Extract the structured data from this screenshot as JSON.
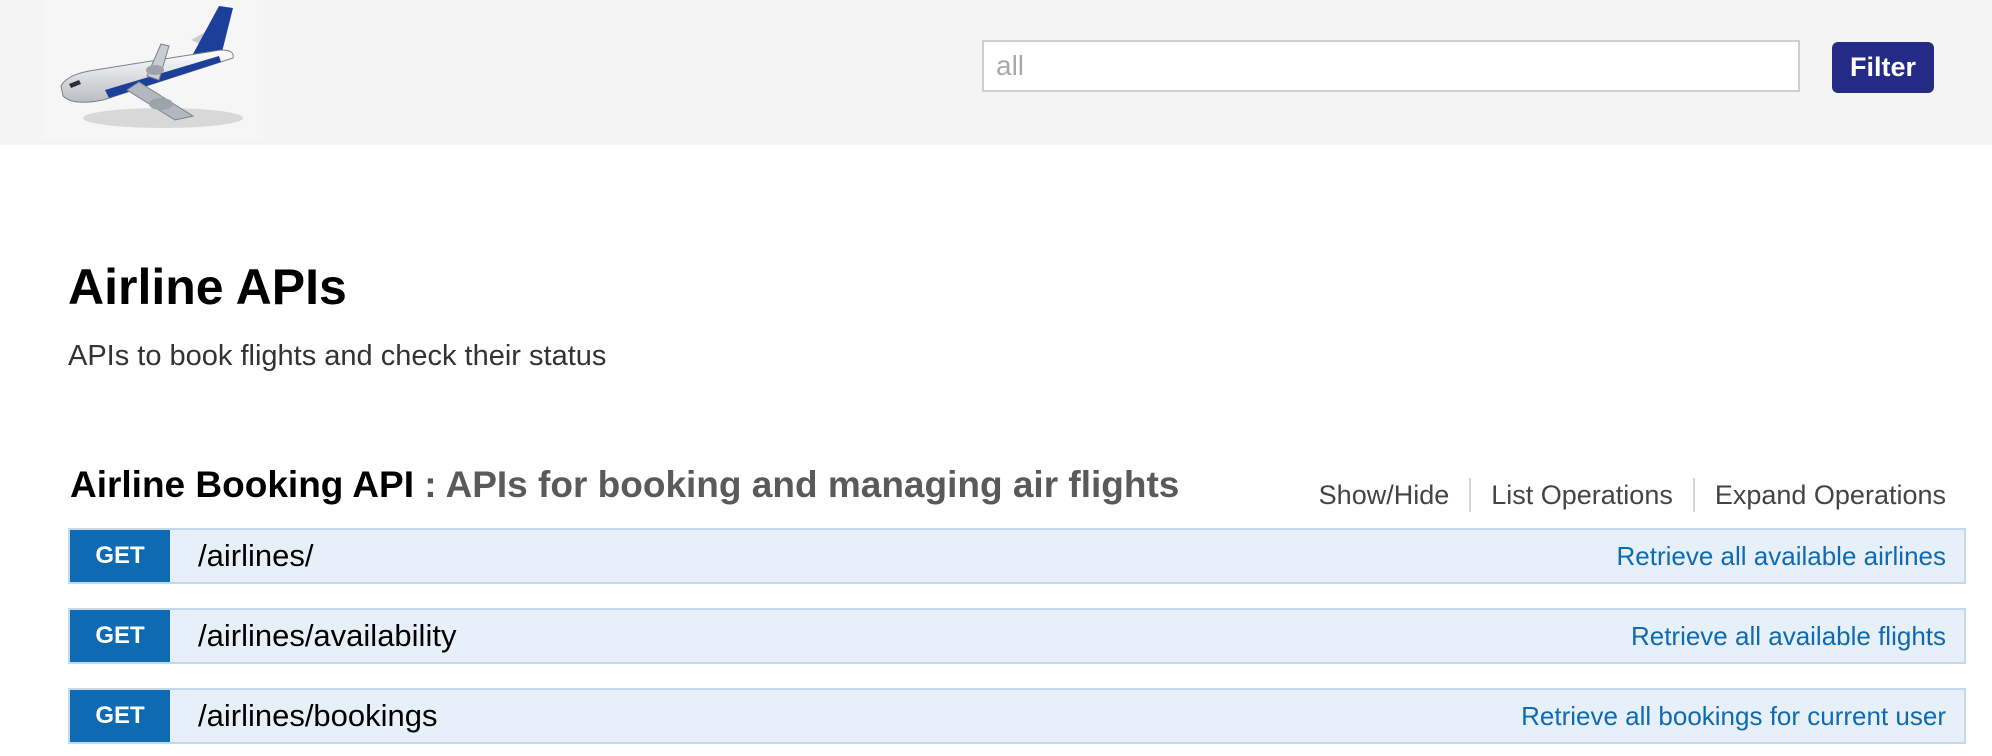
{
  "header": {
    "logo_icon": "airplane-logo-icon",
    "filter_placeholder": "all",
    "filter_value": "",
    "filter_button_label": "Filter",
    "filter_button_color": "#232b86"
  },
  "info": {
    "title": "Airline APIs",
    "description": "APIs to book flights and check their status"
  },
  "resource": {
    "name": "Airline Booking API",
    "separator": " : ",
    "description": "APIs for booking and managing air flights",
    "options": [
      {
        "label": "Show/Hide"
      },
      {
        "label": "List Operations"
      },
      {
        "label": "Expand Operations"
      }
    ]
  },
  "operations": [
    {
      "method": "GET",
      "path": "/airlines/",
      "summary": "Retrieve all available airlines"
    },
    {
      "method": "GET",
      "path": "/airlines/availability",
      "summary": "Retrieve all available flights"
    },
    {
      "method": "GET",
      "path": "/airlines/bookings",
      "summary": "Retrieve all bookings for current user"
    }
  ],
  "colors": {
    "get_badge": "#0f6ab4",
    "operation_background": "#e7f0f8",
    "operation_border": "#c3d9ec",
    "summary_text": "#0f6ab4"
  }
}
